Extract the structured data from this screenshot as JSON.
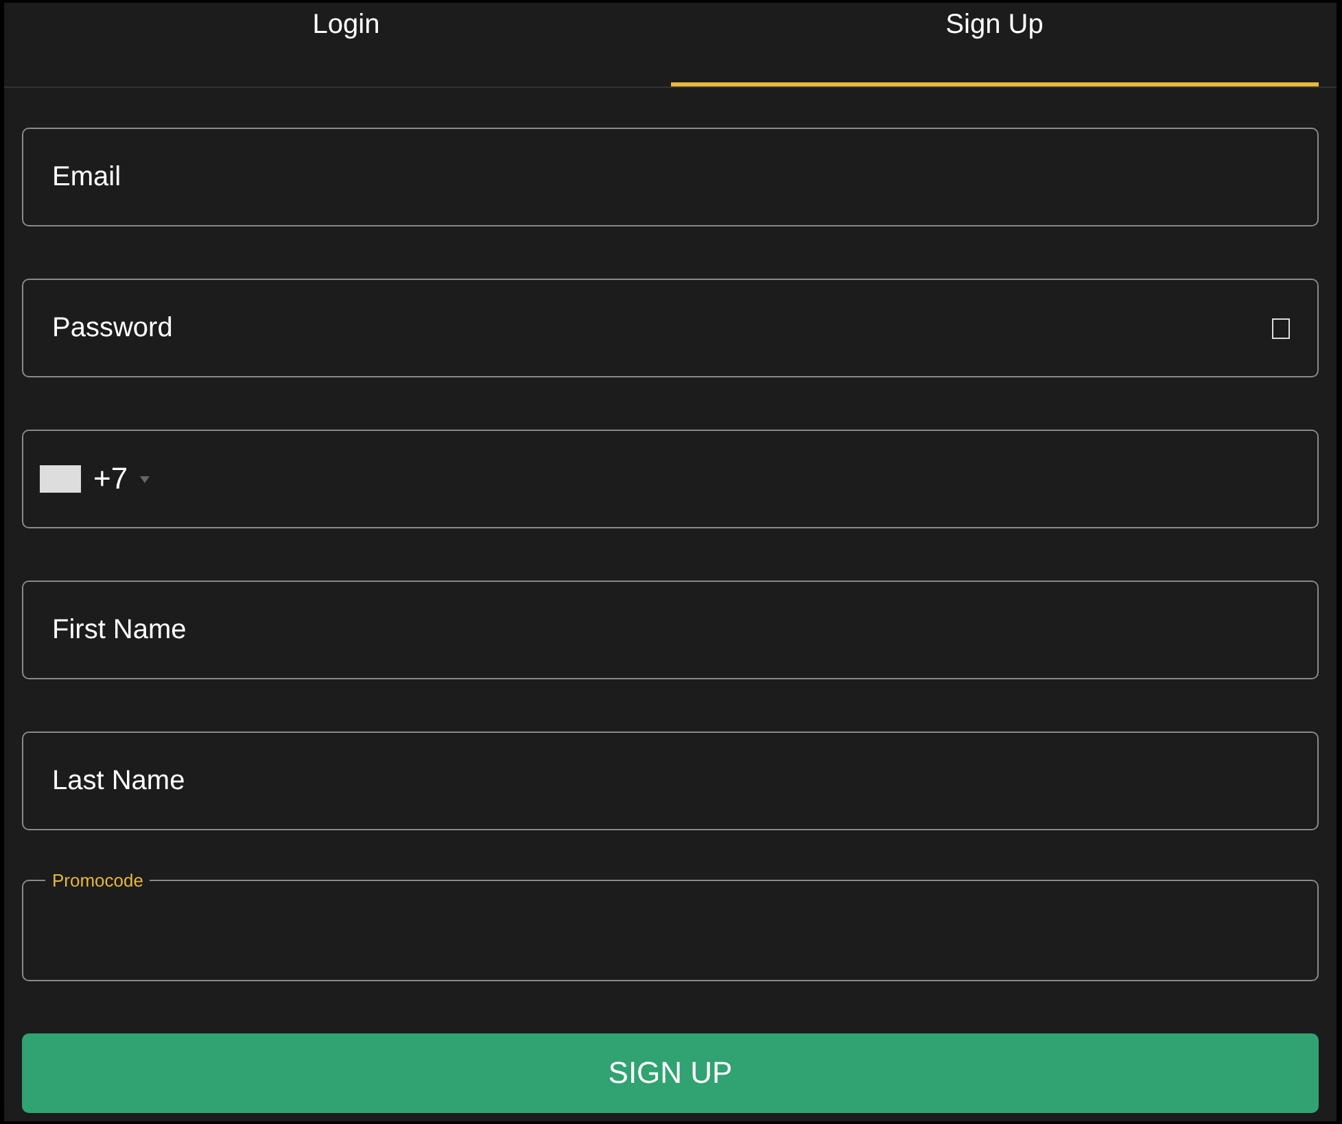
{
  "tabs": [
    {
      "label": "Login",
      "selected": false
    },
    {
      "label": "Sign Up",
      "selected": true
    }
  ],
  "fields": [
    {
      "kind": "text",
      "placeholder": "Email"
    },
    {
      "kind": "password",
      "placeholder": "Password"
    },
    {
      "kind": "phone",
      "code": "+7"
    },
    {
      "kind": "text",
      "placeholder": "First Name"
    },
    {
      "kind": "text",
      "placeholder": "Last Name"
    },
    {
      "kind": "outlined",
      "label": "Promocode"
    }
  ],
  "submit": "SIGN UP"
}
